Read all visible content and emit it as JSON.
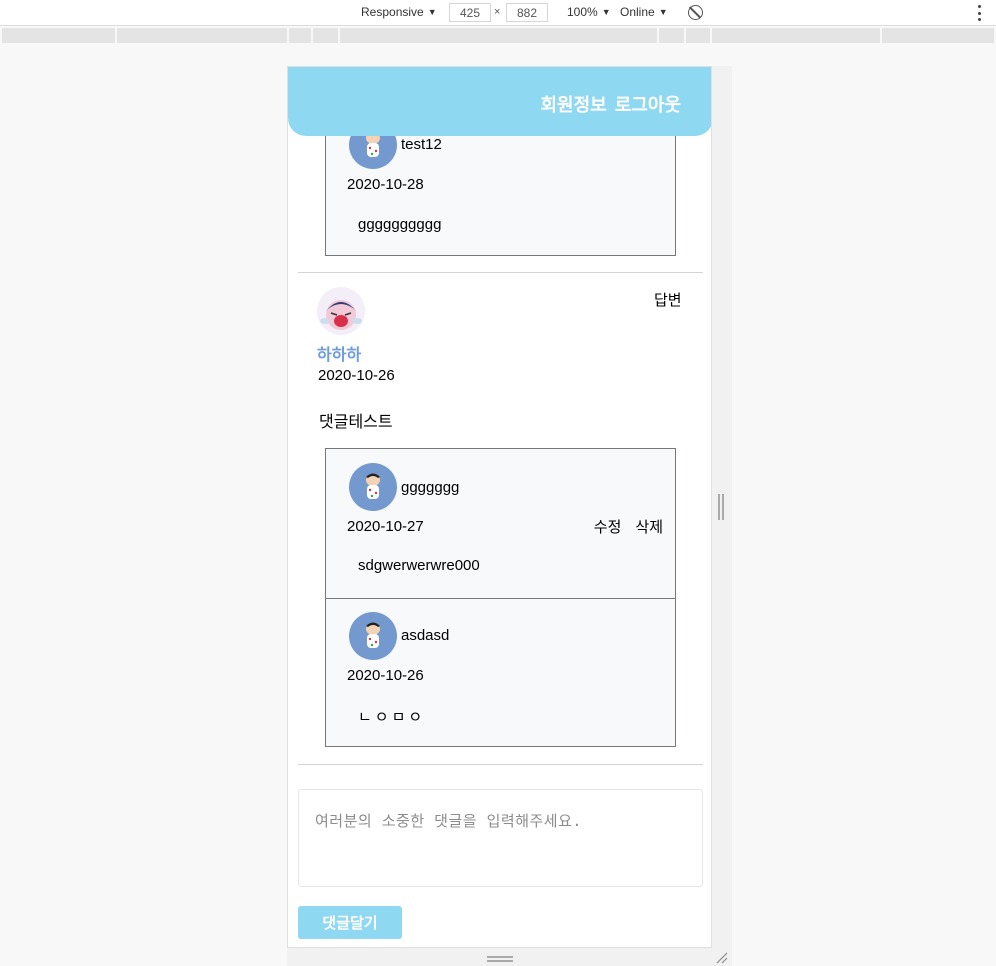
{
  "devtools": {
    "device": "Responsive",
    "width": "425",
    "height": "882",
    "times": "×",
    "zoom": "100%",
    "network": "Online",
    "caret": "▼"
  },
  "header": {
    "links": [
      "회원정보",
      "로그아웃"
    ]
  },
  "top_reply": {
    "author": "test12",
    "date": "2020-10-28",
    "text": "gggggggggg"
  },
  "comment": {
    "author": "하하하",
    "date": "2020-10-26",
    "text": "댓글테스트",
    "reply_label": "답변",
    "replies": [
      {
        "author": "ggggggg",
        "date": "2020-10-27",
        "text": "sdgwerwerwre000",
        "edit_label": "수정",
        "delete_label": "삭제"
      },
      {
        "author": "asdasd",
        "date": "2020-10-26",
        "text": "ㄴㅇㅁㅇ"
      }
    ]
  },
  "input": {
    "placeholder": "여러분의 소중한 댓글을 입력해주세요."
  },
  "submit_label": "댓글달기"
}
